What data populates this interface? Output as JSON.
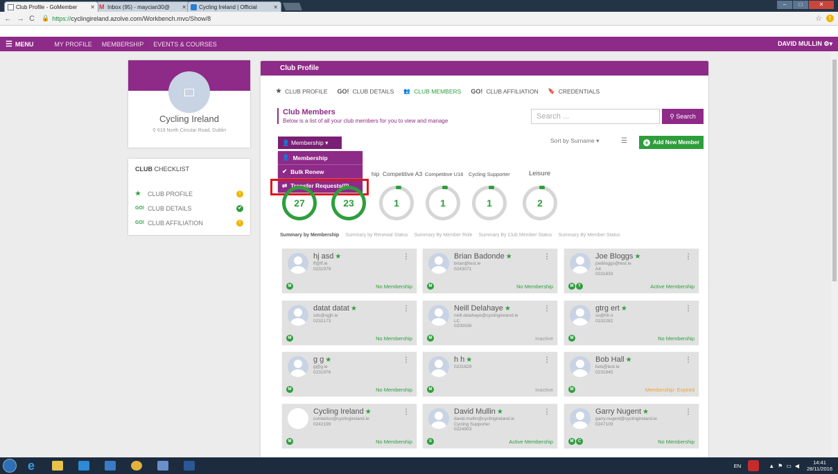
{
  "browser": {
    "tabs": [
      {
        "label": "Club Profile - GoMember",
        "active": true
      },
      {
        "label": "Inbox (95) - maycian30@",
        "active": false
      },
      {
        "label": "Cycling Ireland | Official",
        "active": false
      }
    ],
    "url_proto": "https://",
    "url_rest": "cyclingireland.azolve.com/Workbench.mvc/Show/8"
  },
  "nav": {
    "menu": "MENU",
    "links": [
      "MY PROFILE",
      "MEMBERSHIP",
      "EVENTS & COURSES"
    ],
    "user": "DAVID MULLIN"
  },
  "club": {
    "name": "Cycling Ireland",
    "address": "619 North Circular Road, Dublin"
  },
  "checklist": {
    "title_bold": "CLUB",
    "title_rest": " CHECKLIST",
    "items": [
      {
        "label": "CLUB PROFILE",
        "icon": "★",
        "status": "!"
      },
      {
        "label": "CLUB DETAILS",
        "icon": "GO!",
        "status": "✔"
      },
      {
        "label": "CLUB AFFILIATION",
        "icon": "GO!",
        "status": "!"
      }
    ]
  },
  "panel": {
    "title": "Club Profile",
    "tabs": [
      {
        "label": "CLUB PROFILE",
        "icon": "★"
      },
      {
        "label": "CLUB DETAILS",
        "icon": "GO!"
      },
      {
        "label": "CLUB MEMBERS",
        "icon": "👥"
      },
      {
        "label": "CLUB AFFILIATION",
        "icon": "GO!"
      },
      {
        "label": "CREDENTIALS",
        "icon": "🔖"
      }
    ],
    "section_title": "Club Members",
    "section_sub": "Below is a list of all your club members for you to view and manage",
    "search_placeholder": "Search ...",
    "search_button": "Search",
    "membership_button": "Membership ▾",
    "dropdown": [
      "Membership",
      "Bulk Renew",
      "Transfer Requests(0)"
    ],
    "sort_label": "Sort by Surname ▾",
    "add_button": "Add New Member",
    "categories": [
      "hip",
      "Competitive A3",
      "Competitive U16",
      "Cycling Supporter",
      "Leisure"
    ],
    "circles": [
      "27",
      "23",
      "1",
      "1",
      "1",
      "2"
    ],
    "summary_tabs": [
      "Summary by Membership",
      "Summary by Renewal Status",
      "Summary By Member Role",
      "Summary By Club Member Status",
      "Summary By Member Status"
    ]
  },
  "members": [
    {
      "name": "hj asd",
      "info": [
        "ff@ff.ie",
        "0231979"
      ],
      "badges": [
        "M"
      ],
      "status": "No Membership",
      "tone": "green",
      "blank": false
    },
    {
      "name": "Brian Badonde",
      "info": [
        "brian@test.ie",
        "0243071"
      ],
      "badges": [
        "M"
      ],
      "status": "No Membership",
      "tone": "green",
      "blank": false
    },
    {
      "name": "Joe Bloggs",
      "info": [
        "joebloggs@test.ie",
        "A4",
        "0231833"
      ],
      "badges": [
        "M",
        "T"
      ],
      "status": "Active Membership",
      "tone": "green",
      "blank": false
    },
    {
      "name": "datat datat",
      "info": [
        "sds@sgjh.ie",
        "0232173"
      ],
      "badges": [
        "M"
      ],
      "status": "No Membership",
      "tone": "green",
      "blank": false
    },
    {
      "name": "Neill Delahaye",
      "info": [
        "neill.delahaye@cyclingireland.ie",
        "LC",
        "0200036"
      ],
      "badges": [
        "M"
      ],
      "status": "Inactive",
      "tone": "gray",
      "blank": false
    },
    {
      "name": "gtrg ert",
      "info": [
        "ss@hh.ir",
        "0232282"
      ],
      "badges": [
        "M"
      ],
      "status": "No Membership",
      "tone": "green",
      "blank": false
    },
    {
      "name": "g g",
      "info": [
        "g@g.ie",
        "0231976"
      ],
      "badges": [
        "M"
      ],
      "status": "No Membership",
      "tone": "green",
      "blank": false
    },
    {
      "name": "h h",
      "info": [
        "0231829"
      ],
      "badges": [
        "M"
      ],
      "status": "Inactive",
      "tone": "gray",
      "blank": false
    },
    {
      "name": "Bob Hall",
      "info": [
        "bob@test.ie",
        "0231845"
      ],
      "badges": [
        "M"
      ],
      "status": "Membership- Expired",
      "tone": "orange",
      "blank": false
    },
    {
      "name": "Cycling Ireland",
      "info": [
        "contactus@cyclingireland.ie",
        "0242199"
      ],
      "badges": [
        "M"
      ],
      "status": "No Membership",
      "tone": "green",
      "blank": true
    },
    {
      "name": "David Mullin",
      "info": [
        "david.mullin@cyclingireland.ie",
        "Cycling Supporter",
        "0224903"
      ],
      "badges": [
        "S"
      ],
      "status": "Active Membership",
      "tone": "green",
      "blank": false
    },
    {
      "name": "Garry Nugent",
      "info": [
        "garry.nugent@cyclingireland.ie",
        "0247109"
      ],
      "badges": [
        "M",
        "C"
      ],
      "status": "No Membership",
      "tone": "green",
      "blank": false
    }
  ],
  "taskbar": {
    "lang": "EN",
    "time": "14:41",
    "date": "28/11/2016"
  },
  "colors": {
    "brand": "#8e2a87",
    "success": "#2e9e3c",
    "warning": "#f0b400",
    "highlight": "#e0141e"
  }
}
